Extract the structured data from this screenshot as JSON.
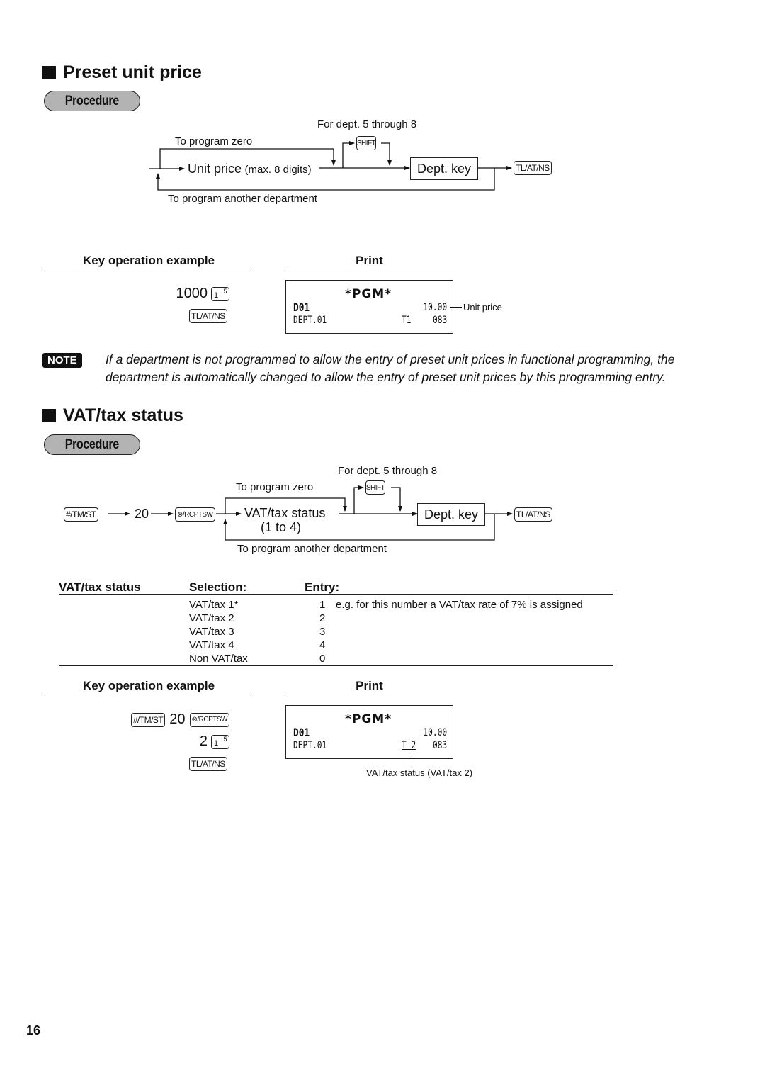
{
  "page_number": "16",
  "sections": [
    {
      "title": "Preset unit price",
      "procedure_label": "Procedure",
      "diagram": {
        "for_dept_note": "For dept. 5 through 8",
        "to_program_zero": "To program zero",
        "input_label": "Unit price",
        "input_hint": "(max. 8 digits)",
        "shift_key": "SHIFT",
        "dept_key": "Dept. key",
        "end_key": "TL/AT/NS",
        "loop_label": "To program another department"
      },
      "key_example": {
        "heading": "Key operation example",
        "lines": [
          {
            "value": "1000",
            "key_main": "1",
            "key_sup": "5"
          },
          {
            "key": "TL/AT/NS"
          }
        ]
      },
      "print": {
        "heading": "Print",
        "header": "*PGM*",
        "line1_left": "D01",
        "line1_right": "10.00",
        "line2_left": "DEPT.01",
        "line2_mid": "T1",
        "line2_right": "083",
        "callout": "Unit price"
      },
      "note": {
        "badge": "NOTE",
        "text": "If a department is not programmed to allow the entry of preset unit prices in functional programming, the department is automatically changed to allow the entry of preset unit prices by this programming entry."
      }
    },
    {
      "title": "VAT/tax status",
      "procedure_label": "Procedure",
      "diagram": {
        "start_key": "#/TM/ST",
        "code": "20",
        "receipt_key": "⊗/RCPTSW",
        "for_dept_note": "For dept. 5 through 8",
        "to_program_zero": "To program zero",
        "input_label": "VAT/tax status",
        "input_hint": "(1 to 4)",
        "shift_key": "SHIFT",
        "dept_key": "Dept. key",
        "end_key": "TL/AT/NS",
        "loop_label": "To program another department"
      },
      "table": {
        "headers": [
          "VAT/tax status",
          "Selection:",
          "Entry:"
        ],
        "rows": [
          {
            "selection": "VAT/tax 1*",
            "entry": "1",
            "note": "e.g. for this number a VAT/tax rate of 7% is assigned"
          },
          {
            "selection": "VAT/tax 2",
            "entry": "2",
            "note": ""
          },
          {
            "selection": "VAT/tax 3",
            "entry": "3",
            "note": ""
          },
          {
            "selection": "VAT/tax 4",
            "entry": "4",
            "note": ""
          },
          {
            "selection": "Non VAT/tax",
            "entry": "0",
            "note": ""
          }
        ]
      },
      "key_example": {
        "heading": "Key operation example",
        "line1_key_a": "#/TM/ST",
        "line1_value": "20",
        "line1_key_b": "⊗/RCPTSW",
        "line2_value": "2",
        "line2_key_main": "1",
        "line2_key_sup": "5",
        "line3_key": "TL/AT/NS"
      },
      "print": {
        "heading": "Print",
        "header": "*PGM*",
        "line1_left": "D01",
        "line1_right": "10.00",
        "line2_left": "DEPT.01",
        "line2_mid": "T 2",
        "line2_right": "083",
        "callout": "VAT/tax status (VAT/tax 2)"
      }
    }
  ]
}
